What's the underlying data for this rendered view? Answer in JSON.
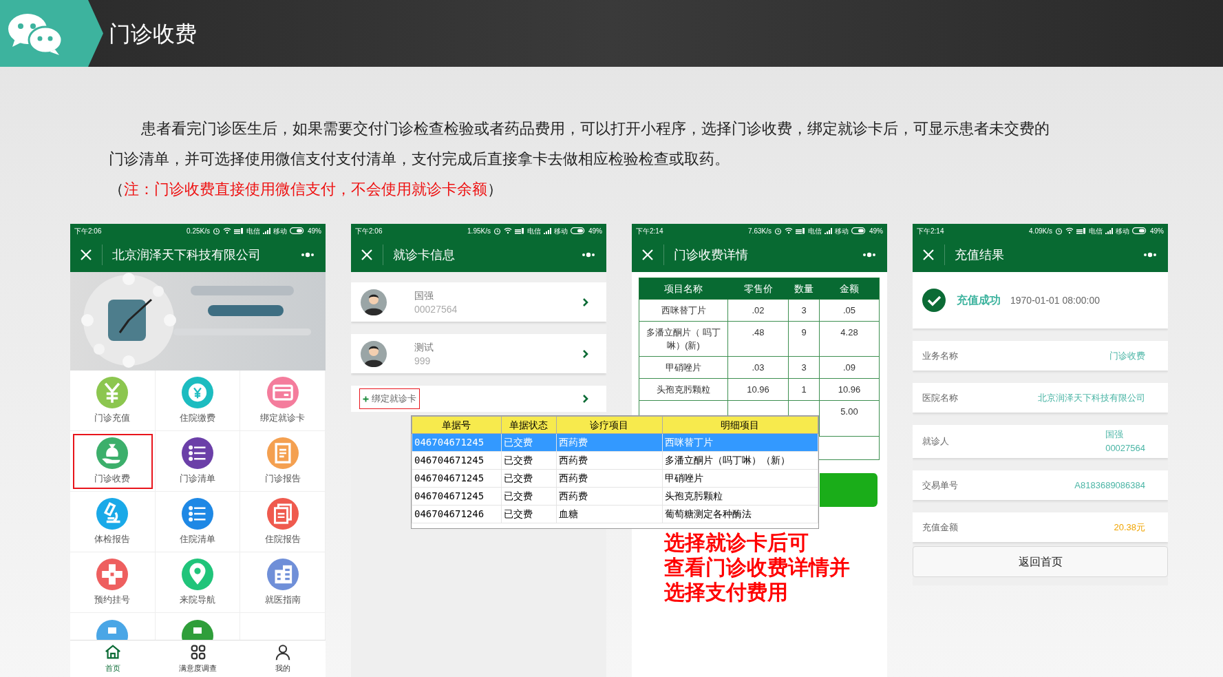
{
  "header": {
    "title": "门诊收费"
  },
  "intro": {
    "lines": [
      "患者看完门诊医生后，如果需要交付门诊检查检验或者药品费用，可以打开小程序，选择门诊收费，绑定就诊卡后，可显示患者未交费的",
      "门诊清单，并可选择使用微信支付支付清单，支付完成后直接拿卡去做相应检验检查或取药。"
    ],
    "note": {
      "before": "（",
      "highlight": "注：门诊收费直接使用微信支付，不会使用就诊卡余额",
      "after": "）"
    }
  },
  "phones": [
    {
      "kind": "home",
      "status_bar": {
        "time": "下午2:06",
        "speed": "0.25K/s",
        "carrier_1": "电信",
        "carrier_2": "移动",
        "battery": "49%"
      },
      "title": "北京润泽天下科技有限公司",
      "menu": [
        {
          "label": "门诊充值",
          "color": "#8cc64f",
          "highlighted": false
        },
        {
          "label": "住院缴费",
          "color": "#1cbcc0",
          "highlighted": false
        },
        {
          "label": "绑定就诊卡",
          "color": "#f47c9c",
          "highlighted": false
        },
        {
          "label": "门诊收费",
          "color": "#3caf6b",
          "highlighted": true
        },
        {
          "label": "门诊清单",
          "color": "#6b3fa8",
          "highlighted": false
        },
        {
          "label": "门诊报告",
          "color": "#f4a050",
          "highlighted": false
        },
        {
          "label": "体检报告",
          "color": "#1aa9e8",
          "highlighted": false
        },
        {
          "label": "住院清单",
          "color": "#1e88e5",
          "highlighted": false
        },
        {
          "label": "住院报告",
          "color": "#ef5a4e",
          "highlighted": false
        },
        {
          "label": "预约挂号",
          "color": "#ee5f5f",
          "highlighted": false
        },
        {
          "label": "来院导航",
          "color": "#20c47a",
          "highlighted": false
        },
        {
          "label": "就医指南",
          "color": "#6f8fd8",
          "highlighted": false
        }
      ],
      "partial_menu": [
        {
          "color": "#4aa6e6"
        },
        {
          "color": "#2f9e3a"
        }
      ],
      "tab_bar": [
        {
          "label": "首页",
          "selected": true
        },
        {
          "label": "满意度调查",
          "selected": false
        },
        {
          "label": "我的",
          "selected": false
        }
      ]
    },
    {
      "kind": "cards",
      "status_bar": {
        "time": "下午2:06",
        "speed": "1.95K/s",
        "carrier_1": "电信",
        "carrier_2": "移动",
        "battery": "49%"
      },
      "title": "就诊卡信息",
      "cards": [
        {
          "name": "国强",
          "number": "00027564"
        },
        {
          "name": "测试",
          "number": "999"
        }
      ],
      "bind": {
        "label": "绑定就诊卡",
        "highlighted": true
      }
    },
    {
      "kind": "fee_detail",
      "status_bar": {
        "time": "下午2:14",
        "speed": "7.63K/s",
        "carrier_1": "电信",
        "carrier_2": "移动",
        "battery": "49%"
      },
      "title": "门诊收费详情",
      "columns": [
        "项目名称",
        "零售价",
        "数量",
        "金额"
      ],
      "rows": [
        {
          "name": "西咪替丁片",
          "price": ".02",
          "qty": "3",
          "amount": ".05"
        },
        {
          "name": "多潘立酮片（ 吗丁啉）(新)",
          "price": ".48",
          "qty": "9",
          "amount": "4.28"
        },
        {
          "name": "甲硝唑片",
          "price": ".03",
          "qty": "3",
          "amount": ".09"
        },
        {
          "name": "头孢克肟颗粒",
          "price": "10.96",
          "qty": "1",
          "amount": "10.96"
        },
        {
          "amount": "5.00"
        }
      ]
    },
    {
      "kind": "result",
      "status_bar": {
        "time": "下午2:14",
        "speed": "4.09K/s",
        "carrier_1": "电信",
        "carrier_2": "移动",
        "battery": "49%"
      },
      "title": "充值结果",
      "result": {
        "status": "充值成功",
        "time": "1970-01-01 08:00:00"
      },
      "fields": [
        {
          "label": "业务名称",
          "values": [
            "门诊收费"
          ],
          "kind": "text"
        },
        {
          "label": "医院名称",
          "values": [
            "北京润泽天下科技有限公司"
          ],
          "kind": "text"
        },
        {
          "label": "就诊人",
          "values": [
            "国强",
            "00027564"
          ],
          "kind": "text"
        },
        {
          "label": "交易单号",
          "values": [
            "A8183689086384"
          ],
          "kind": "text"
        },
        {
          "label": "充值金额",
          "values": [
            "20.38元"
          ],
          "kind": "amount"
        }
      ],
      "button": "返回首页"
    }
  ],
  "overlay_table": {
    "columns": [
      "单据号",
      "单据状态",
      "诊疗项目",
      "明细项目"
    ],
    "rows": [
      {
        "cells": [
          "046704671245",
          "已交费",
          "西药费",
          "西咪替丁片"
        ],
        "selected": true
      },
      {
        "cells": [
          "046704671245",
          "已交费",
          "西药费",
          "多潘立酮片（吗丁啉）（新）"
        ],
        "selected": false
      },
      {
        "cells": [
          "046704671245",
          "已交费",
          "西药费",
          "甲硝唑片"
        ],
        "selected": false
      },
      {
        "cells": [
          "046704671245",
          "已交费",
          "西药费",
          "头孢克肟颗粒"
        ],
        "selected": false
      },
      {
        "cells": [
          "046704671246",
          "已交费",
          "血糖",
          "葡萄糖测定各种酶法"
        ],
        "selected": false
      }
    ]
  },
  "caption": {
    "lines": [
      "选择就诊卡后可",
      "查看门诊收费详情并",
      "选择支付费用"
    ]
  }
}
